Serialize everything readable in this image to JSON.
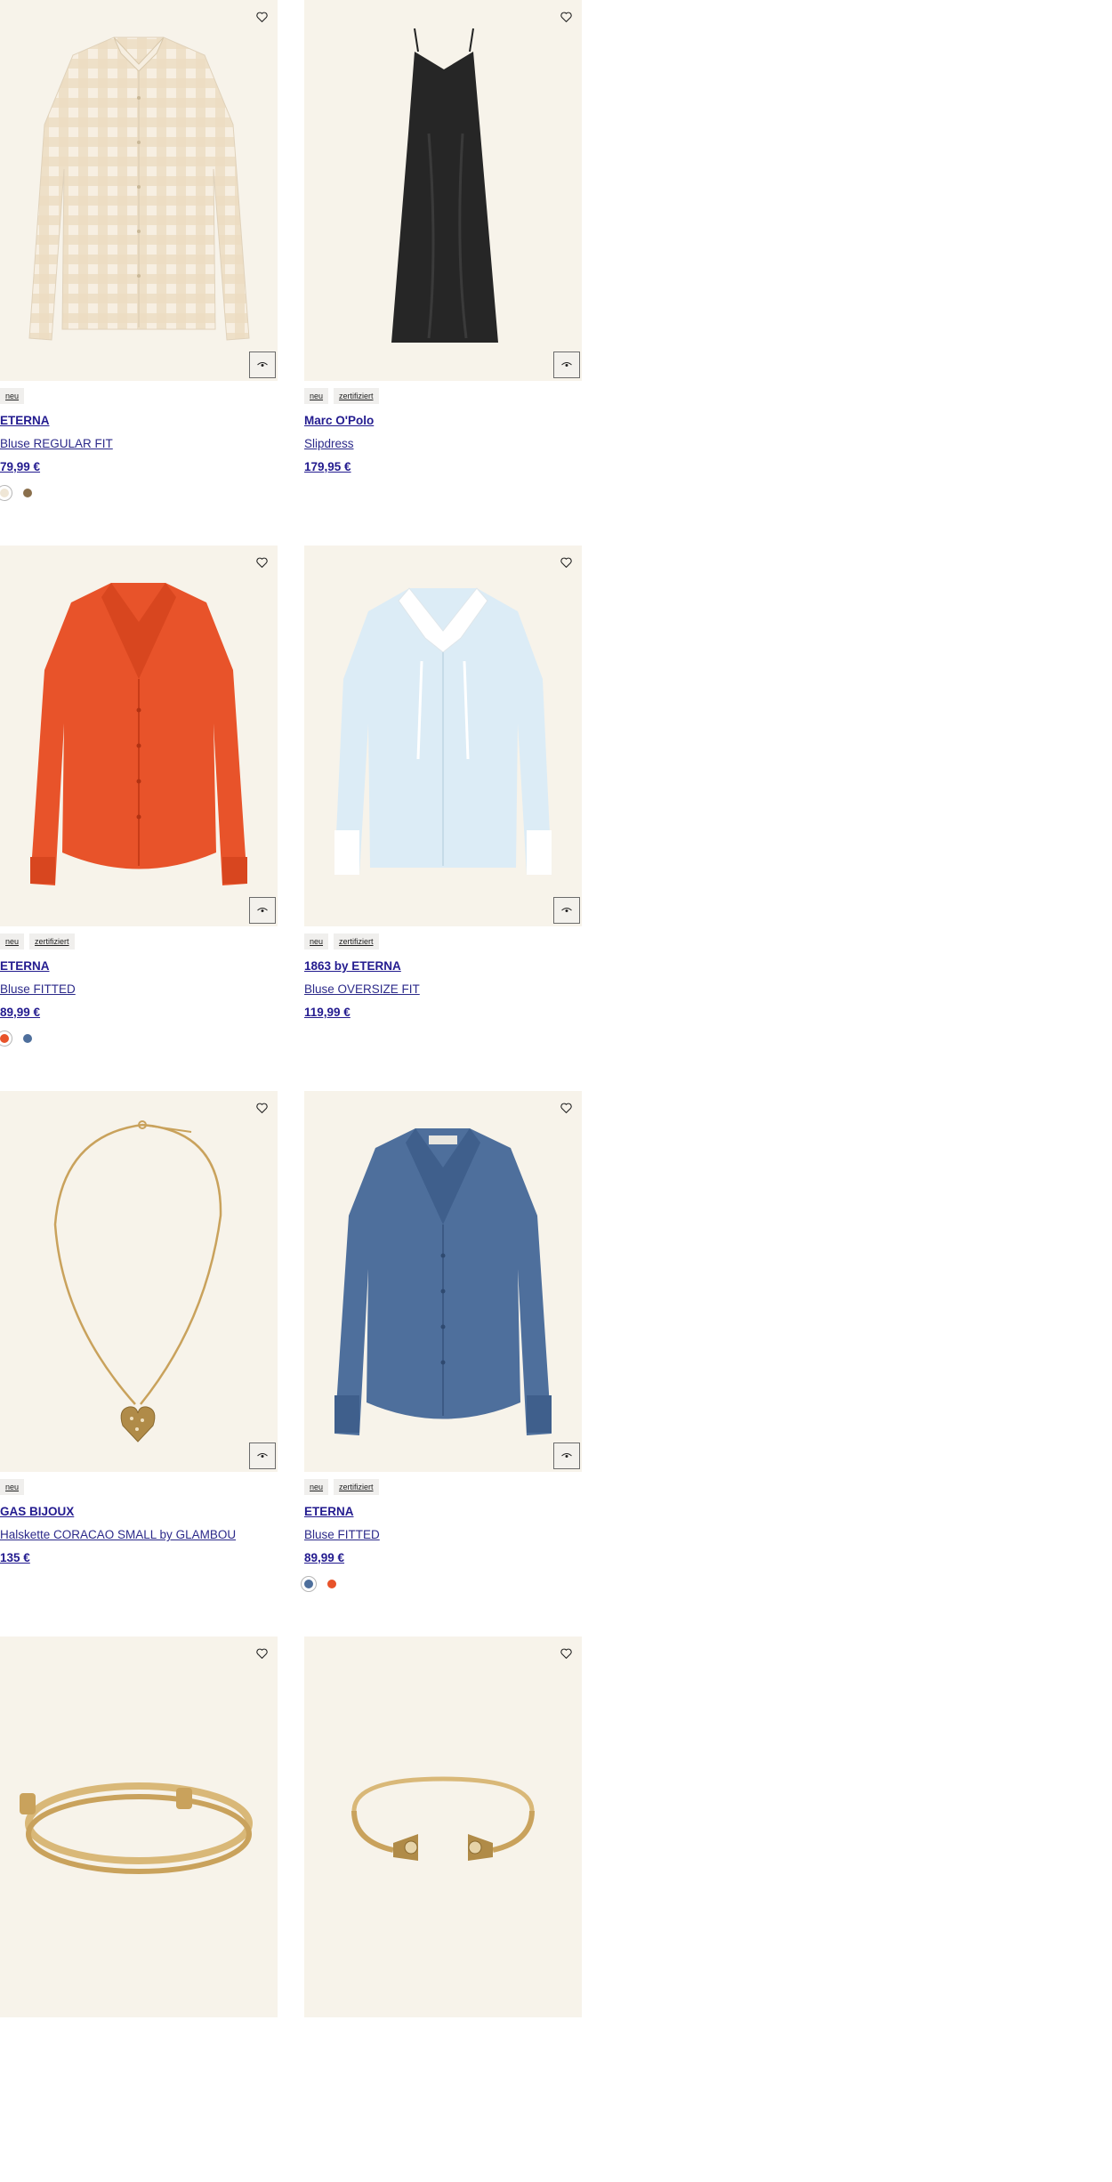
{
  "products": [
    {
      "badges": [
        "neu"
      ],
      "brand": "ETERNA",
      "name": "Bluse REGULAR FIT",
      "price": "79,99 €",
      "swatches": [
        "#efe6d6",
        "#8a6f4c"
      ]
    },
    {
      "badges": [
        "neu",
        "zertifiziert"
      ],
      "brand": "Marc O'Polo",
      "name": "Slipdress",
      "price": "179,95 €",
      "swatches": []
    },
    {
      "badges": [
        "neu",
        "zertifiziert"
      ],
      "brand": "ETERNA",
      "name": "Bluse FITTED",
      "price": "89,99 €",
      "swatches": [
        "#e8532a",
        "#4e6f9c"
      ]
    },
    {
      "badges": [
        "neu",
        "zertifiziert"
      ],
      "brand": "1863 by ETERNA",
      "name": "Bluse OVERSIZE FIT",
      "price": "119,99 €",
      "swatches": []
    },
    {
      "badges": [
        "neu"
      ],
      "brand": "GAS BIJOUX",
      "name": "Halskette CORACAO SMALL by GLAMBOU",
      "price": "135 €",
      "swatches": []
    },
    {
      "badges": [
        "neu",
        "zertifiziert"
      ],
      "brand": "ETERNA",
      "name": "Bluse FITTED",
      "price": "89,99 €",
      "swatches": [
        "#4e6f9c",
        "#e8532a"
      ]
    },
    {
      "badges": [],
      "brand": "",
      "name": "",
      "price": "",
      "swatches": []
    },
    {
      "badges": [],
      "brand": "",
      "name": "",
      "price": "",
      "swatches": []
    }
  ],
  "icons": {
    "wishlist": "heart-outline-icon",
    "quickview": "eye-icon"
  },
  "colors": {
    "link": "#231b8f",
    "image_bg": "#f7f3ea"
  }
}
